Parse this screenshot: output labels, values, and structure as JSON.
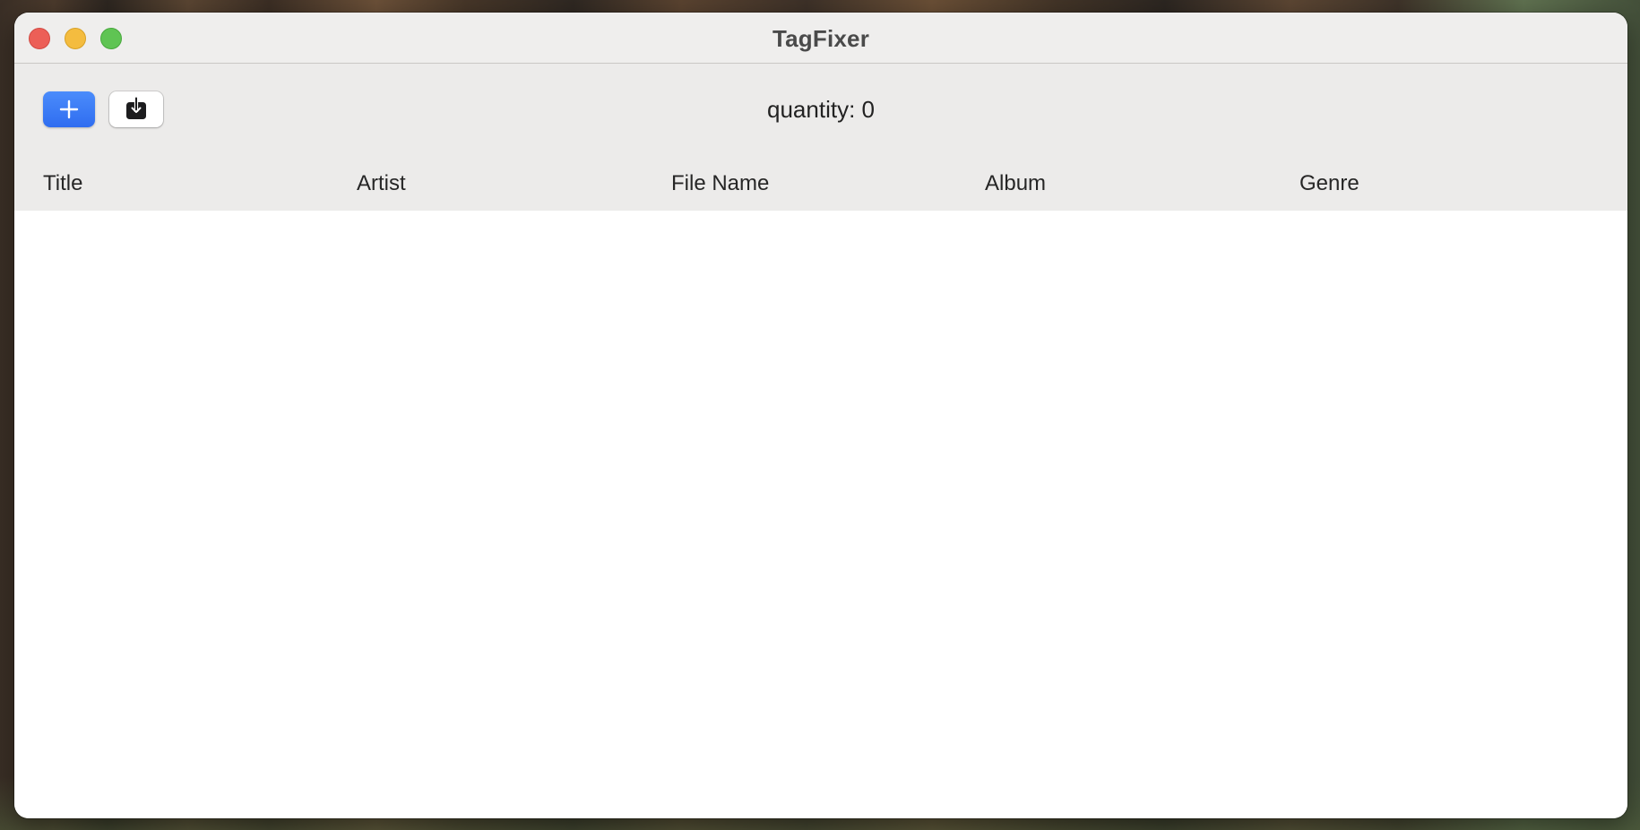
{
  "window": {
    "title": "TagFixer"
  },
  "toolbar": {
    "add_icon": "plus-icon",
    "import_icon": "tray-arrow-down-icon",
    "quantity_label": "quantity:",
    "quantity_value": "0"
  },
  "table": {
    "columns": [
      "Title",
      "Artist",
      "File Name",
      "Album",
      "Genre"
    ],
    "rows": []
  },
  "colors": {
    "accent": "#3478f6",
    "close": "#ec5f57",
    "minimize": "#f4bc3f",
    "zoom": "#5fc453"
  }
}
